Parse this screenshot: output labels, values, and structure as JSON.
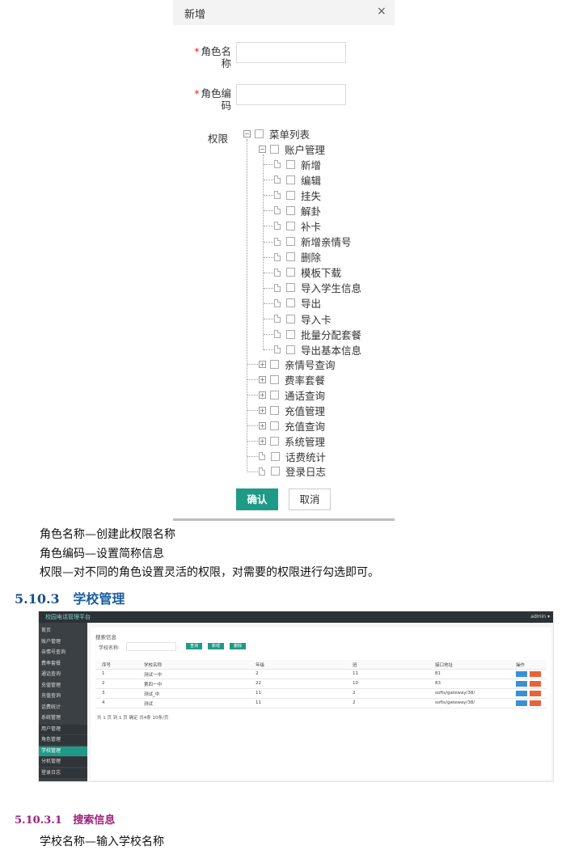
{
  "dialog": {
    "title": "新增",
    "close_symbol": "×",
    "role_name_label": "角色名称",
    "role_code_label": "角色编码",
    "required_mark": "*",
    "permission_label": "权限",
    "tree_root": "菜单列表",
    "tree_group": "账户管理",
    "tree_children": [
      "新增",
      "编辑",
      "挂失",
      "解卦",
      "补卡",
      "新增亲情号",
      "删除",
      "模板下载",
      "导入学生信息",
      "导出",
      "导入卡",
      "批量分配套餐",
      "导出基本信息"
    ],
    "tree_collapsed": [
      "亲情号查询",
      "费率套餐",
      "通话查询",
      "充值管理",
      "充值查询",
      "系统管理"
    ],
    "tree_leaves": [
      "话费统计",
      "登录日志"
    ],
    "confirm_button": "确认",
    "cancel_button": "取消"
  },
  "doc": {
    "line1": "角色名称—创建此权限名称",
    "line2": "角色编码—设置简称信息",
    "line3": "权限—对不同的角色设置灵活的权限，对需要的权限进行勾选即可。",
    "section_num": "5.10.3",
    "section_title": "学校管理",
    "subsection_num": "5.10.3.1",
    "subsection_title": "搜索信息",
    "line4": "学校名称—输入学校名称"
  },
  "admin": {
    "brand": "校园电话管理平台",
    "user": "admin ▾",
    "sidebar": [
      "首页",
      "账户管理",
      "亲情号查询",
      "费率套餐",
      "通话查询",
      "充值管理",
      "充值查询",
      "话费统计",
      "系统管理",
      "用户管理",
      "角色管理",
      "学校管理",
      "分机管理",
      "登录日志"
    ],
    "active_item": "学校管理",
    "search_title": "搜索信息",
    "search_label": "学校名称:",
    "buttons": [
      "查询",
      "新增",
      "删除"
    ],
    "columns": [
      "序号",
      "学校名称",
      "年级",
      "班",
      "接口地址",
      "操作"
    ],
    "rows": [
      [
        "1",
        "测试一中",
        "2",
        "11",
        "81"
      ],
      [
        "2",
        "第四一中",
        "22",
        "10",
        "83"
      ],
      [
        "3",
        "测试_中",
        "11",
        "2",
        "softs/gateway/38/"
      ],
      [
        "4",
        "测试",
        "11",
        "2",
        "softs/gateway/38/"
      ]
    ],
    "pager": "共 1 页 到 1 页 确定 共4条 10条/页"
  },
  "colors": {
    "accent": "#1f9a87",
    "section_blue": "#1a5da0",
    "section_purple": "#a0207c"
  }
}
